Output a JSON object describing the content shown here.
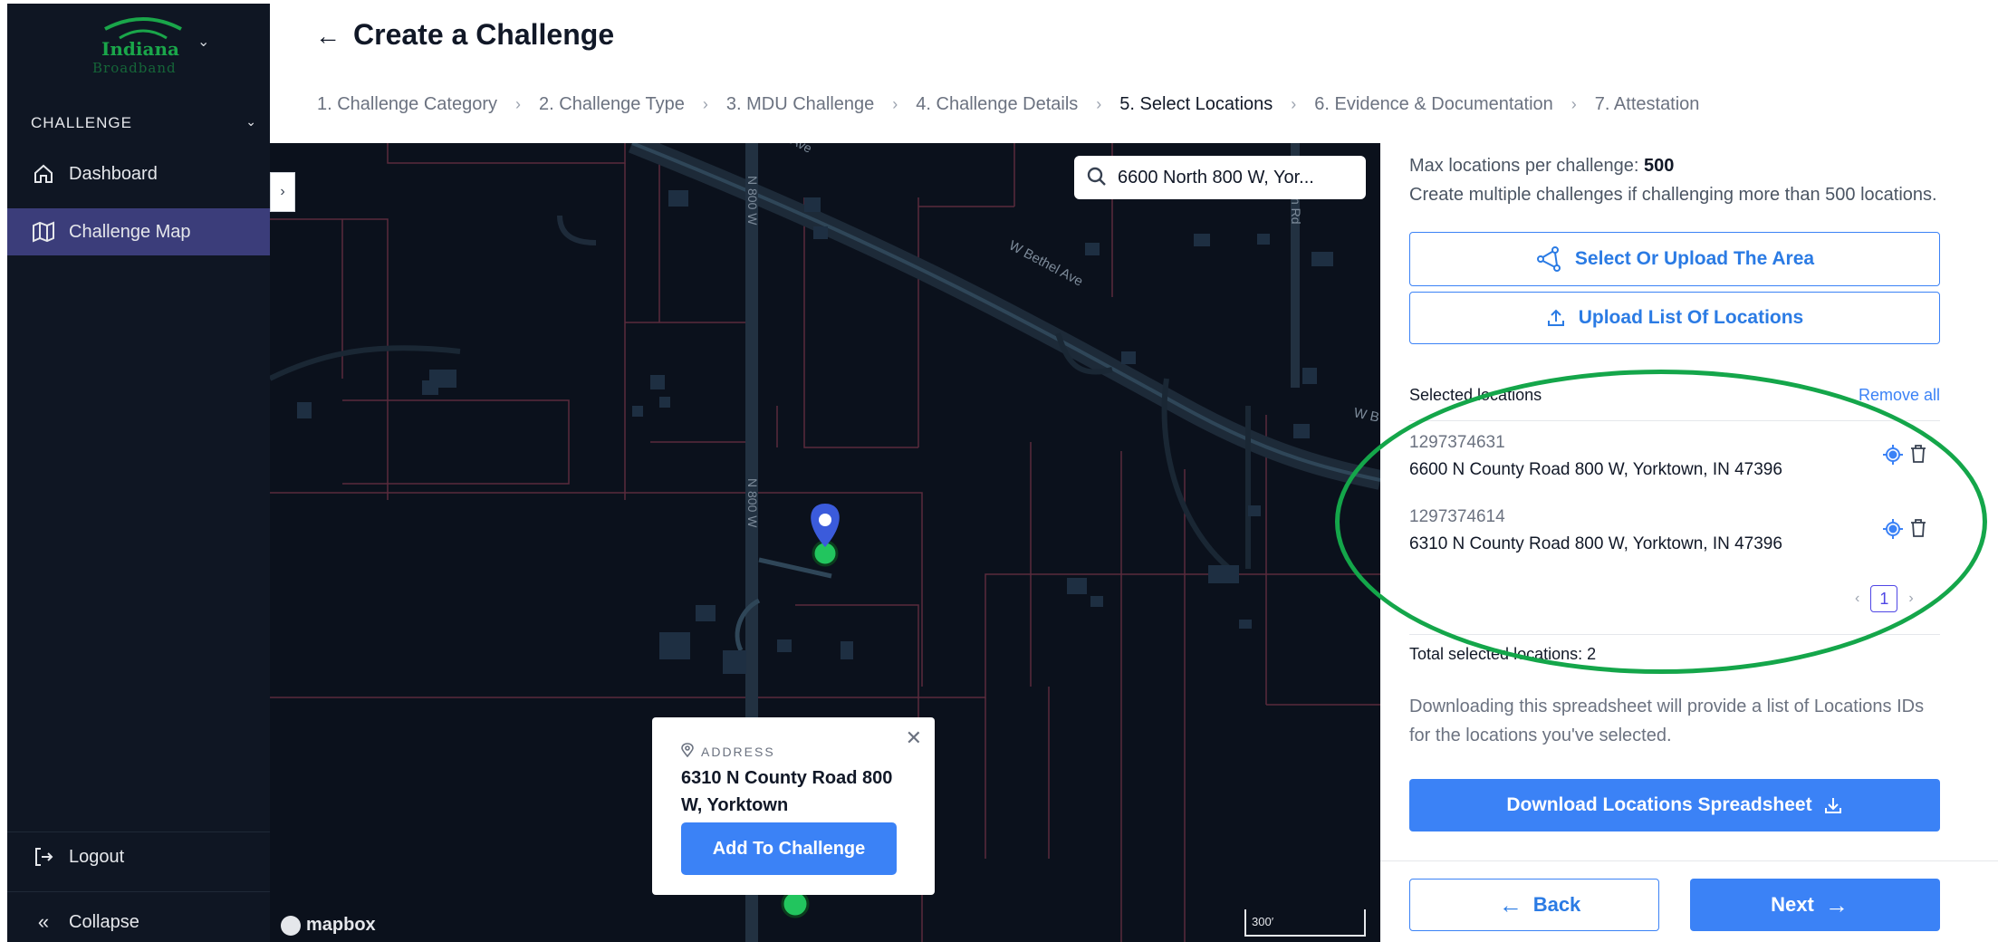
{
  "sidebar": {
    "brand": {
      "name": "Indiana",
      "sub": "Broadband"
    },
    "section": "CHALLENGE",
    "items": [
      {
        "label": "Dashboard",
        "icon": "home-icon"
      },
      {
        "label": "Challenge Map",
        "icon": "map-icon",
        "active": true
      }
    ],
    "logout": "Logout",
    "collapse": "Collapse"
  },
  "header": {
    "title": "Create a Challenge",
    "steps": [
      "1. Challenge Category",
      "2. Challenge Type",
      "3. MDU Challenge",
      "4. Challenge Details",
      "5. Select Locations",
      "6. Evidence & Documentation",
      "7. Attestation"
    ],
    "current_step": 4
  },
  "map": {
    "search_value": "6600 North 800 W, Yor...",
    "road_labels": [
      "N 800 W",
      "W Bethel Ave",
      "W B",
      "n Rd",
      "Ave"
    ],
    "popup": {
      "kicker": "ADDRESS",
      "address": "6310 N County Road 800 W, Yorktown",
      "button": "Add To Challenge"
    },
    "attribution": "mapbox",
    "scale_label": "300′"
  },
  "panel": {
    "max_prefix": "Max locations per challenge: ",
    "max_value": "500",
    "create_multiple": "Create multiple challenges if challenging more than 500 locations.",
    "select_area": "Select Or Upload The Area",
    "upload_list": "Upload List Of Locations",
    "selected_heading": "Selected locations",
    "remove_all": "Remove all",
    "locations": [
      {
        "id": "1297374631",
        "address": "6600 N County Road 800 W, Yorktown, IN 47396"
      },
      {
        "id": "1297374614",
        "address": "6310 N County Road 800 W, Yorktown, IN 47396"
      }
    ],
    "page": "1",
    "total": "Total selected locations: 2",
    "download_text": "Downloading this spreadsheet will provide a list of Locations IDs for the locations you've selected.",
    "download_button": "Download Locations Spreadsheet",
    "back": "Back",
    "next": "Next"
  },
  "colors": {
    "accent": "#3b82f6",
    "sidebar_bg": "#0f1623",
    "sidebar_active": "#3b3d7a",
    "map_bg": "#0b111c",
    "annotation": "#14a64a"
  }
}
